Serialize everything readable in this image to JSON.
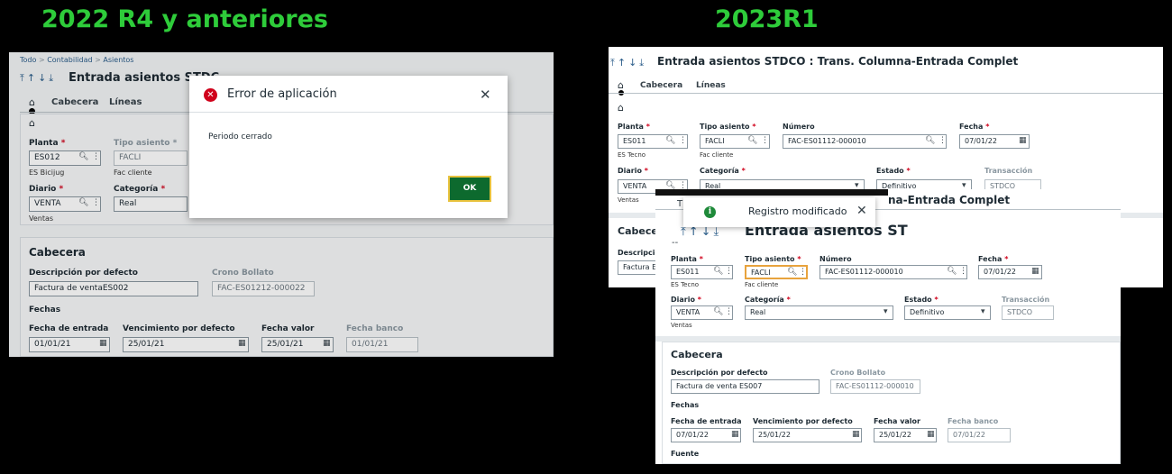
{
  "headings": {
    "left": "2022 R4 y anteriores",
    "right": "2023R1"
  },
  "left": {
    "breadcrumb": [
      "Todo",
      "Contabilidad",
      "Asientos"
    ],
    "title": "Entrada asientos STDC",
    "tabs": [
      "Cabecera",
      "Líneas"
    ],
    "fields": {
      "planta_label": "Planta",
      "planta_value": "ES012",
      "planta_sub": "ES Bicijug",
      "tipo_label": "Tipo asiento",
      "tipo_value": "FACLI",
      "tipo_sub": "Fac cliente",
      "diario_label": "Diario",
      "diario_value": "VENTA",
      "diario_sub": "Ventas",
      "categoria_label": "Categoría",
      "categoria_value": "Real"
    },
    "cabecera": {
      "title": "Cabecera",
      "desc_label": "Descripción por defecto",
      "desc_value": "Factura de ventaES002",
      "crono_label": "Crono Bollato",
      "crono_value": "FAC-ES01212-000022",
      "fechas_label": "Fechas",
      "entrada_label": "Fecha de entrada",
      "entrada_value": "01/01/21",
      "venc_label": "Vencimiento por defecto",
      "venc_value": "25/01/21",
      "valor_label": "Fecha valor",
      "valor_value": "25/01/21",
      "banco_label": "Fecha banco",
      "banco_value": "01/01/21"
    },
    "dialog": {
      "title": "Error de aplicación",
      "message": "Periodo cerrado",
      "ok": "OK"
    }
  },
  "right": {
    "back": {
      "title": "Entrada asientos STDCO : Trans. Columna-Entrada Complet",
      "tabs": [
        "Cabecera",
        "Líneas"
      ],
      "planta_label": "Planta",
      "planta_value": "ES011",
      "planta_sub": "ES Tecno",
      "tipo_label": "Tipo asiento",
      "tipo_value": "FACLI",
      "tipo_sub": "Fac cliente",
      "numero_label": "Número",
      "numero_value": "FAC-ES01112-000010",
      "fecha_label": "Fecha",
      "fecha_value": "07/01/22",
      "diario_label": "Diario",
      "diario_value": "VENTA",
      "diario_sub": "Ventas",
      "categoria_label": "Categoría",
      "categoria_value": "Real",
      "estado_label": "Estado",
      "estado_value": "Definitivo",
      "trans_label": "Transacción",
      "trans_value": "STDCO",
      "cab_short": "Cabecer",
      "desc_short": "Descripción",
      "desc_value_short": "Factura E"
    },
    "front": {
      "title_suffix": "na-Entrada Complet",
      "title": "Entrada asientos ST",
      "planta_label": "Planta",
      "planta_value": "ES011",
      "planta_sub": "ES Tecno",
      "tipo_label": "Tipo asiento",
      "tipo_value": "FACLI",
      "tipo_sub": "Fac cliente",
      "numero_label": "Número",
      "numero_value": "FAC-ES01112-000010",
      "fecha_label": "Fecha",
      "fecha_value": "07/01/22",
      "diario_label": "Diario",
      "diario_value": "VENTA",
      "diario_sub": "Ventas",
      "categoria_label": "Categoría",
      "categoria_value": "Real",
      "estado_label": "Estado",
      "estado_value": "Definitivo",
      "trans_label": "Transacción",
      "trans_value": "STDCO",
      "cabecera": {
        "title": "Cabecera",
        "desc_label": "Descripción por defecto",
        "desc_value": "Factura de venta ES007",
        "crono_label": "Crono Bollato",
        "crono_value": "FAC-ES01112-000010",
        "fechas_label": "Fechas",
        "entrada_label": "Fecha de entrada",
        "entrada_value": "07/01/22",
        "venc_label": "Vencimiento por defecto",
        "venc_value": "25/01/22",
        "valor_label": "Fecha valor",
        "valor_value": "25/01/22",
        "banco_label": "Fecha banco",
        "banco_value": "07/01/22",
        "fuente_label": "Fuente"
      }
    },
    "toast": {
      "message": "Registro modificado"
    }
  },
  "colors": {
    "heading": "#2ecc3a",
    "ok_button": "#0d6a2e",
    "error_icon": "#d0021b",
    "success_icon": "#1f8a3a",
    "required": "#d0021b"
  }
}
